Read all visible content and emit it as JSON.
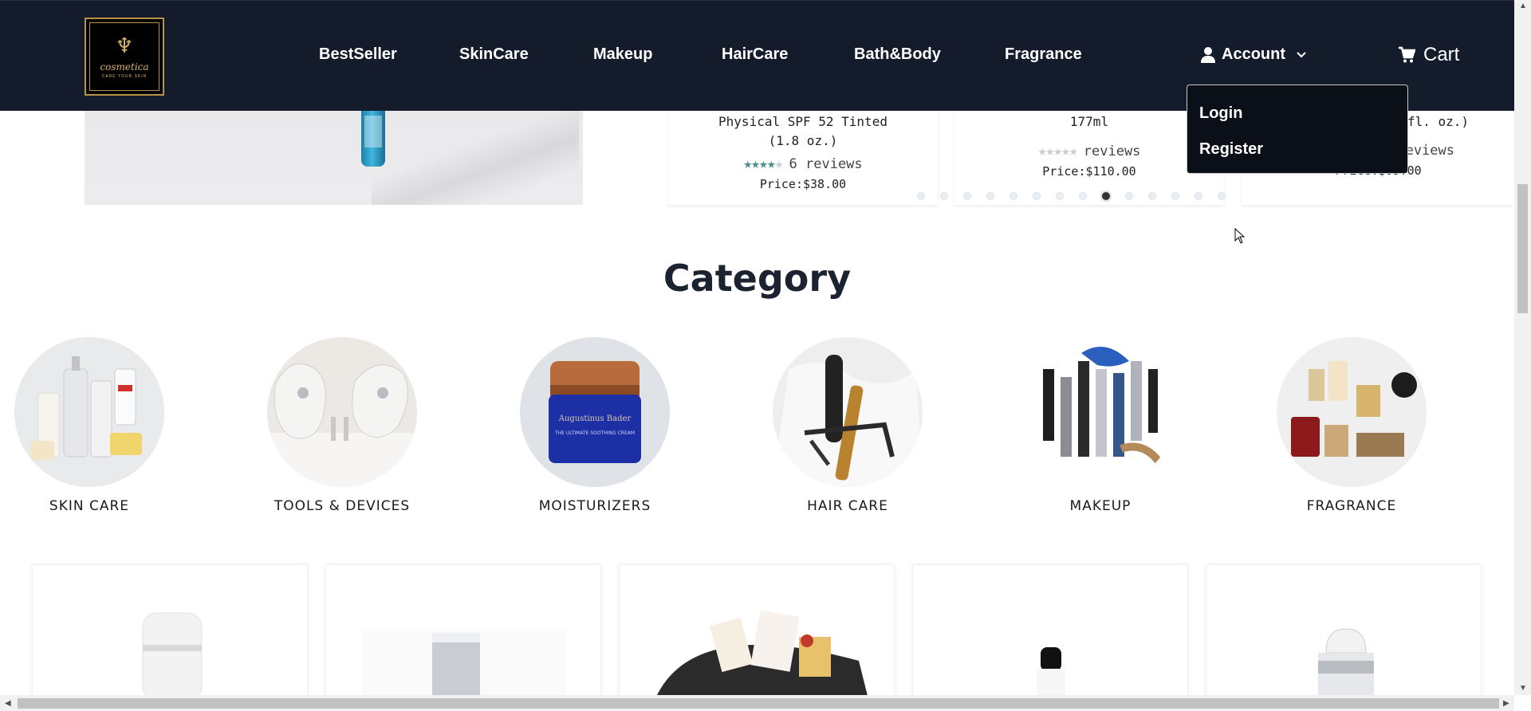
{
  "brand": {
    "name": "cosmetica",
    "tagline": "CARE YOUR SKIN"
  },
  "nav": {
    "links": [
      "BestSeller",
      "SkinCare",
      "Makeup",
      "HairCare",
      "Bath&Body",
      "Fragrance"
    ],
    "account_label": "Account",
    "cart_label": "Cart",
    "dropdown": {
      "login": "Login",
      "register": "Register"
    }
  },
  "featured": [
    {
      "name": "Physical SPF 52 Tinted (1.8 oz.)",
      "rating_count": "6 reviews",
      "stars_filled": 4,
      "price": "Price:$38.00"
    },
    {
      "name": "177ml",
      "rating_count": "reviews",
      "stars_filled": 0,
      "price": "Price:$110.00"
    },
    {
      "name": "fl. oz.)",
      "rating_count": "eviews",
      "stars_filled": 0,
      "price": "Price:$69.00"
    }
  ],
  "carousel": {
    "dot_count": 14,
    "active_index": 8
  },
  "category": {
    "title": "Category",
    "items": [
      {
        "label": "SKIN CARE"
      },
      {
        "label": "TOOLS & DEVICES"
      },
      {
        "label": "MOISTURIZERS"
      },
      {
        "label": "HAIR CARE"
      },
      {
        "label": "MAKEUP"
      },
      {
        "label": "FRAGRANCE"
      }
    ]
  },
  "colors": {
    "navbar_bg": "#141c2b",
    "accent_teal": "#4c8f8f",
    "logo_gold": "#d7b56d"
  }
}
